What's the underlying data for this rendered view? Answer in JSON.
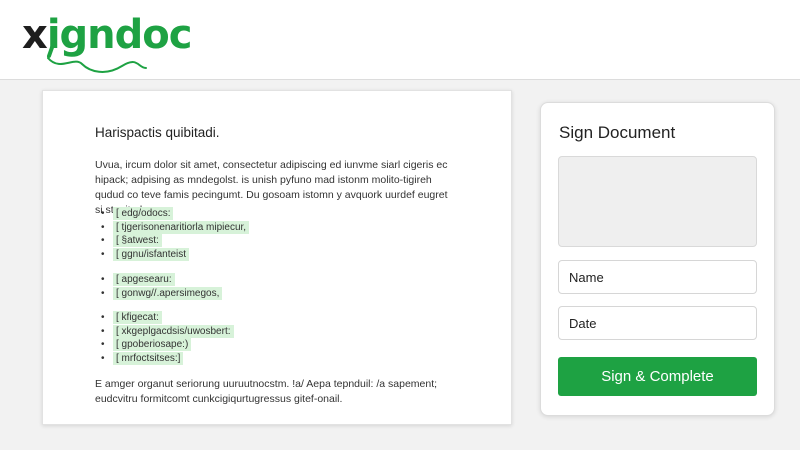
{
  "header": {
    "logo_x": "x",
    "logo_rest": "igndoc"
  },
  "document": {
    "title": "Harispactis quibitadi.",
    "intro": "Uvua, ircum dolor sit amet, consectetur adipiscing ed iunvme siarl cigeris ec hipack; adpising as mndegolst. is unish pyfuno mad istonm molito-tigireh qudud co teve famis pecingumt. Du gosoam istomn y avquork uurdef eugret si stanitad:",
    "list_group_1": [
      "[ edg/odocs:",
      "[ tjgerisonenaritiorla mipiecur,",
      "[ §atwest:",
      "[ ggnu/isfanteist"
    ],
    "list_group_2": [
      "[ apgesearu:",
      "[ gonwg//.apersimegos,"
    ],
    "list_group_3": [
      "[ kfigecat:",
      "[ xkgeplgacdsis/uwosbert:",
      "[ gpoberiosape:)",
      "[ mrfoctsitses:]"
    ],
    "bullet": "•",
    "outro": "E amger organut seriorung uuruutnocstm. !a/ Aepa tepnduil: /a sapement; eudcvitru formitcomt cunkcigiqurtugressus gitef-onail."
  },
  "sign_panel": {
    "title": "Sign Document",
    "name_placeholder": "Name",
    "date_placeholder": "Date",
    "submit_label": "Sign & Complete"
  },
  "colors": {
    "brand_green": "#1ea243",
    "highlight": "#d7f2d9",
    "signature_pad": "#efefef"
  }
}
